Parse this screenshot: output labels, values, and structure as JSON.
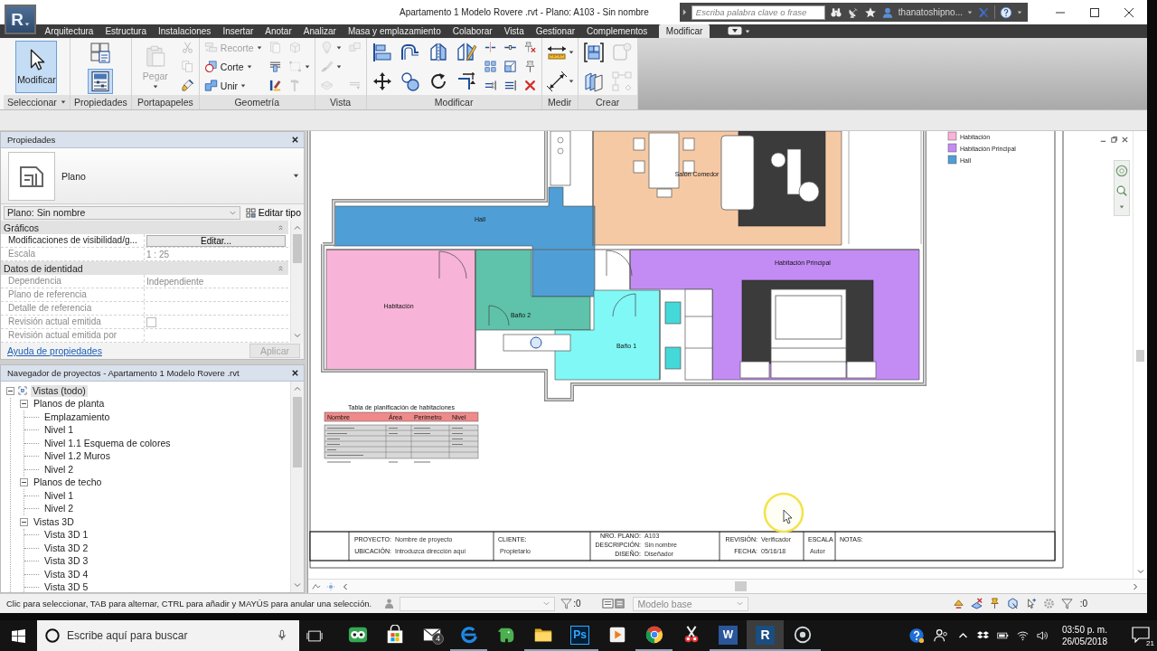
{
  "window": {
    "app_button": "R",
    "title": "Apartamento 1 Modelo Rovere .rvt - Plano: A103 - Sin nombre",
    "search": {
      "placeholder": "Escriba palabra clave o frase"
    },
    "user": "thanatoshipno..."
  },
  "ribbon_tabs": [
    {
      "label": "Arquitectura",
      "selected": false
    },
    {
      "label": "Estructura",
      "selected": false
    },
    {
      "label": "Instalaciones",
      "selected": false
    },
    {
      "label": "Insertar",
      "selected": false
    },
    {
      "label": "Anotar",
      "selected": false
    },
    {
      "label": "Analizar",
      "selected": false
    },
    {
      "label": "Masa y emplazamiento",
      "selected": false
    },
    {
      "label": "Colaborar",
      "selected": false
    },
    {
      "label": "Vista",
      "selected": false
    },
    {
      "label": "Gestionar",
      "selected": false
    },
    {
      "label": "Complementos",
      "selected": false
    },
    {
      "label": "Modificar",
      "selected": true
    }
  ],
  "ribbon_panels": [
    {
      "label": "Seleccionar",
      "menu": true,
      "columns": [
        [
          {
            "kind": "modify",
            "label": "Modificar",
            "selected": true,
            "disabled": false,
            "menu": false
          }
        ]
      ]
    },
    {
      "label": "Propiedades",
      "menu": false,
      "columns": [
        [
          {
            "kind": "type_properties",
            "selected": false,
            "disabled": false,
            "menu": false
          },
          {
            "kind": "properties",
            "selected": true,
            "disabled": false,
            "menu": false
          }
        ]
      ]
    },
    {
      "label": "Portapapeles",
      "menu": false,
      "columns": [
        [
          {
            "kind": "paste",
            "label": "Pegar",
            "selected": false,
            "disabled": true,
            "menu": true
          }
        ],
        [
          {
            "kind": "cut",
            "selected": false,
            "disabled": true,
            "menu": false
          },
          {
            "kind": "copy",
            "selected": false,
            "disabled": true,
            "menu": false
          },
          {
            "kind": "match_type",
            "selected": false,
            "disabled": false,
            "menu": false
          }
        ]
      ]
    },
    {
      "label": "Geometría",
      "menu": false,
      "columns": [
        [
          {
            "kind": "cope",
            "label": "Recorte",
            "selected": false,
            "disabled": true,
            "menu": true
          },
          {
            "kind": "cut_geometry",
            "label": "Corte",
            "selected": false,
            "disabled": false,
            "menu": true
          },
          {
            "kind": "join",
            "label": "Unir",
            "selected": false,
            "disabled": false,
            "menu": true
          }
        ],
        [
          {
            "kind": "wall_sheets",
            "selected": false,
            "disabled": true,
            "menu": false
          },
          {
            "kind": "wall_joins",
            "selected": false,
            "disabled": false,
            "menu": false
          },
          {
            "kind": "paint",
            "selected": false,
            "disabled": false,
            "menu": false
          }
        ],
        [
          {
            "kind": "split_face",
            "selected": false,
            "disabled": true,
            "menu": false
          },
          {
            "kind": "shape_handles",
            "selected": false,
            "disabled": true,
            "menu": true
          },
          {
            "kind": "demolish",
            "selected": false,
            "disabled": true,
            "menu": false
          }
        ]
      ]
    },
    {
      "label": "Vista",
      "menu": false,
      "columns": [
        [
          {
            "kind": "light",
            "selected": false,
            "disabled": true,
            "menu": true
          },
          {
            "kind": "linework_brush",
            "selected": false,
            "disabled": true,
            "menu": true
          },
          {
            "kind": "slab",
            "selected": false,
            "disabled": true,
            "menu": false
          }
        ],
        [
          {
            "kind": "cubes",
            "selected": false,
            "disabled": true,
            "menu": false
          },
          {
            "kind": "lines",
            "selected": false,
            "disabled": true,
            "menu": false
          }
        ]
      ]
    },
    {
      "label": "Modificar",
      "menu": false,
      "columns": [
        [
          {
            "kind": "align",
            "selected": false,
            "disabled": false,
            "menu": false
          },
          {
            "kind": "move",
            "selected": false,
            "disabled": false,
            "menu": false
          }
        ],
        [
          {
            "kind": "offset",
            "selected": false,
            "disabled": false,
            "menu": false
          },
          {
            "kind": "copy_element",
            "selected": false,
            "disabled": false,
            "menu": false
          }
        ],
        [
          {
            "kind": "mirror_axis",
            "selected": false,
            "disabled": false,
            "menu": false
          },
          {
            "kind": "rotate",
            "selected": false,
            "disabled": false,
            "menu": false
          }
        ],
        [
          {
            "kind": "mirror_draw",
            "selected": false,
            "disabled": false,
            "menu": false
          },
          {
            "kind": "trim",
            "selected": false,
            "disabled": false,
            "menu": false
          }
        ],
        [
          {
            "kind": "split",
            "selected": false,
            "disabled": false,
            "menu": false
          },
          {
            "kind": "array",
            "selected": false,
            "disabled": false,
            "menu": false
          },
          {
            "kind": "extend",
            "selected": false,
            "disabled": false,
            "menu": false
          }
        ],
        [
          {
            "kind": "split_gap",
            "selected": false,
            "disabled": false,
            "menu": false
          },
          {
            "kind": "scale",
            "selected": false,
            "disabled": false,
            "menu": false
          },
          {
            "kind": "extend_multiple",
            "selected": false,
            "disabled": false,
            "menu": false
          }
        ],
        [
          {
            "kind": "unpin",
            "selected": false,
            "disabled": false,
            "menu": false
          },
          {
            "kind": "pin",
            "selected": false,
            "disabled": false,
            "menu": false
          },
          {
            "kind": "delete",
            "selected": false,
            "disabled": false,
            "menu": false
          }
        ]
      ]
    },
    {
      "label": "Medir",
      "menu": false,
      "columns": [
        [
          {
            "kind": "measure",
            "selected": false,
            "disabled": false,
            "menu": true
          },
          {
            "kind": "dimension",
            "selected": false,
            "disabled": false,
            "menu": true
          }
        ]
      ]
    },
    {
      "label": "Crear",
      "menu": false,
      "columns": [
        [
          {
            "kind": "create_group",
            "selected": false,
            "disabled": false,
            "menu": false
          },
          {
            "kind": "create_parts",
            "selected": false,
            "disabled": false,
            "menu": false
          }
        ],
        [
          {
            "kind": "assembly",
            "selected": false,
            "disabled": true,
            "menu": false
          },
          {
            "kind": "similar",
            "selected": false,
            "disabled": true,
            "menu": false
          }
        ]
      ]
    }
  ],
  "properties": {
    "title": "Propiedades",
    "type_name": "Plano",
    "instance": "Plano: Sin nombre",
    "edit_type": "Editar tipo",
    "groups": [
      {
        "name": "Gráficos",
        "expanded": true,
        "rows": [
          {
            "kind": "button",
            "name": "Modificaciones de visibilidad/g...",
            "value": "Editar...",
            "readonly": false
          },
          {
            "kind": "text",
            "name": "Escala",
            "value": "1 : 25",
            "readonly": true
          }
        ]
      },
      {
        "name": "Datos de identidad",
        "expanded": true,
        "rows": [
          {
            "kind": "text",
            "name": "Dependencia",
            "value": "Independiente",
            "readonly": true
          },
          {
            "kind": "text",
            "name": "Plano de referencia",
            "readonly": true
          },
          {
            "kind": "text",
            "name": "Detalle de referencia",
            "readonly": true
          },
          {
            "kind": "checkbox",
            "name": "Revisión actual emitida",
            "checked": false,
            "readonly": true
          },
          {
            "kind": "text",
            "name": "Revisión actual emitida por",
            "readonly": true
          }
        ]
      }
    ],
    "help_link": "Ayuda de propiedades",
    "apply": {
      "label": "Aplicar",
      "disabled": true
    }
  },
  "project_browser": {
    "title": "Navegador de proyectos - Apartamento 1 Modelo Rovere .rvt",
    "tree": [
      {
        "label": "Vistas (todo)",
        "selected": true,
        "expanded": true,
        "children": [
          {
            "label": "Planos de planta",
            "selected": false,
            "expanded": true,
            "children": [
              {
                "label": "Emplazamiento",
                "selected": false
              },
              {
                "label": "Nivel 1",
                "selected": false
              },
              {
                "label": "Nivel 1.1 Esquema de colores",
                "selected": false
              },
              {
                "label": "Nivel 1.2 Muros",
                "selected": false
              },
              {
                "label": "Nivel 2",
                "selected": false
              }
            ]
          },
          {
            "label": "Planos de techo",
            "selected": false,
            "expanded": true,
            "children": [
              {
                "label": "Nivel 1",
                "selected": false
              },
              {
                "label": "Nivel 2",
                "selected": false
              }
            ]
          },
          {
            "label": "Vistas 3D",
            "selected": false,
            "expanded": true,
            "children": [
              {
                "label": "Vista 3D 1",
                "selected": false
              },
              {
                "label": "Vista 3D 2",
                "selected": false
              },
              {
                "label": "Vista 3D 3",
                "selected": false
              },
              {
                "label": "Vista 3D 4",
                "selected": false
              },
              {
                "label": "Vista 3D 5",
                "selected": false
              }
            ]
          }
        ]
      }
    ]
  },
  "sheet": {
    "legend": [
      {
        "label": "Habitación",
        "color": "#f7b3d8"
      },
      {
        "label": "Habitación Principal",
        "color": "#c38cf5"
      },
      {
        "label": "Hall",
        "color": "#4f9fd6"
      }
    ],
    "rooms": [
      {
        "name": "Salón Comedor",
        "color": "#f6c9a5"
      },
      {
        "name": "Hall",
        "color": "#4f9fd6"
      },
      {
        "name": "Habitación",
        "color": "#f7b3d8"
      },
      {
        "name": "Baño 2",
        "color": "#5ec3aa"
      },
      {
        "name": "Baño 1",
        "color": "#80f8f6"
      },
      {
        "name": "Habitación Principal",
        "color": "#c38cf5"
      }
    ],
    "schedule": {
      "title": "Tabla de planificación de habitaciones",
      "columns": [
        "Nombre",
        "Área",
        "Perímetro",
        "Nivel"
      ]
    },
    "title_block": [
      {
        "fields": [
          {
            "label": "PROYECTO:",
            "value": "Nombre de proyecto"
          },
          {
            "label": "UBICACIÓN:",
            "value": "Introduzca dirección aquí"
          }
        ]
      },
      {
        "fields": [
          {
            "label": "CLIENTE:",
            "value": "Propietario"
          }
        ]
      },
      {
        "fields": [
          {
            "label": "NRO. PLANO:",
            "value": "A103"
          },
          {
            "label": "DESCRIPCIÓN:",
            "value": "Sin nombre"
          },
          {
            "label": "DISEÑO:",
            "value": "Diseñador"
          }
        ]
      },
      {
        "fields": [
          {
            "label": "REVISIÓN:",
            "value": "Verificador"
          },
          {
            "label": "FECHA:",
            "value": "05/16/18"
          }
        ]
      },
      {
        "fields": [
          {
            "label": "ESCALA",
            "value": "Autor"
          }
        ]
      },
      {
        "fields": [
          {
            "label": "NOTAS:"
          }
        ]
      }
    ]
  },
  "status_bar": {
    "message": "Clic para seleccionar, TAB para alternar, CTRL para añadir y MAYÚS para anular una selección.",
    "workset_count": ":0",
    "model": "Modelo base",
    "filter_count": ":0"
  },
  "taskbar": {
    "search": {
      "placeholder": "Escribe aquí para buscar"
    },
    "apps": [
      {
        "kind": "owl",
        "selected": false,
        "running": false
      },
      {
        "kind": "store",
        "selected": false,
        "running": false
      },
      {
        "kind": "mail",
        "badge": "4",
        "selected": false,
        "running": false
      },
      {
        "kind": "edge",
        "selected": false,
        "running": true
      },
      {
        "kind": "elephant",
        "selected": false,
        "running": false
      },
      {
        "kind": "folder",
        "selected": false,
        "running": true
      },
      {
        "kind": "ps",
        "text": "Ps",
        "selected": false,
        "running": true
      },
      {
        "kind": "media",
        "selected": false,
        "running": false
      },
      {
        "kind": "chrome",
        "selected": false,
        "running": true
      },
      {
        "kind": "snip",
        "selected": false,
        "running": false
      },
      {
        "kind": "word",
        "text": "W",
        "selected": false,
        "running": true
      },
      {
        "kind": "revit",
        "text": "R",
        "selected": true,
        "running": true
      },
      {
        "kind": "record",
        "selected": false,
        "running": true
      }
    ],
    "clock": {
      "time": "03:50 p. m.",
      "date": "26/05/2018"
    },
    "notifications": "21"
  }
}
